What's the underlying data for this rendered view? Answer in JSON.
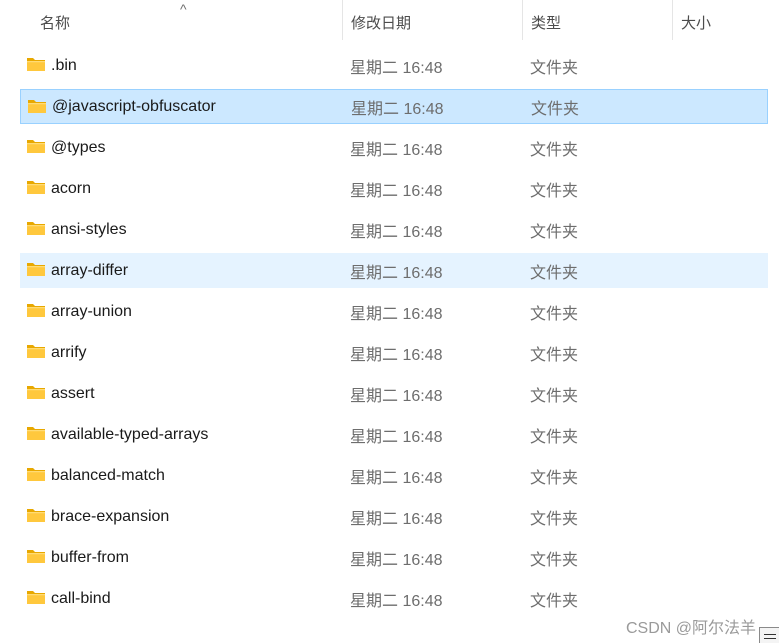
{
  "columns": {
    "name": "名称",
    "date": "修改日期",
    "type": "类型",
    "size": "大小"
  },
  "sort_indicator": "^",
  "rows": [
    {
      "name": ".bin",
      "date": "星期二 16:48",
      "type": "文件夹"
    },
    {
      "name": "@javascript-obfuscator",
      "date": "星期二 16:48",
      "type": "文件夹"
    },
    {
      "name": "@types",
      "date": "星期二 16:48",
      "type": "文件夹"
    },
    {
      "name": "acorn",
      "date": "星期二 16:48",
      "type": "文件夹"
    },
    {
      "name": "ansi-styles",
      "date": "星期二 16:48",
      "type": "文件夹"
    },
    {
      "name": "array-differ",
      "date": "星期二 16:48",
      "type": "文件夹"
    },
    {
      "name": "array-union",
      "date": "星期二 16:48",
      "type": "文件夹"
    },
    {
      "name": "arrify",
      "date": "星期二 16:48",
      "type": "文件夹"
    },
    {
      "name": "assert",
      "date": "星期二 16:48",
      "type": "文件夹"
    },
    {
      "name": "available-typed-arrays",
      "date": "星期二 16:48",
      "type": "文件夹"
    },
    {
      "name": "balanced-match",
      "date": "星期二 16:48",
      "type": "文件夹"
    },
    {
      "name": "brace-expansion",
      "date": "星期二 16:48",
      "type": "文件夹"
    },
    {
      "name": "buffer-from",
      "date": "星期二 16:48",
      "type": "文件夹"
    },
    {
      "name": "call-bind",
      "date": "星期二 16:48",
      "type": "文件夹"
    }
  ],
  "watermark": "CSDN @阿尔法羊",
  "colors": {
    "selected_bg": "#cce8ff",
    "selected_border": "#99d1ff",
    "hover_bg": "#e5f3ff",
    "folder": "#ffc83d"
  }
}
